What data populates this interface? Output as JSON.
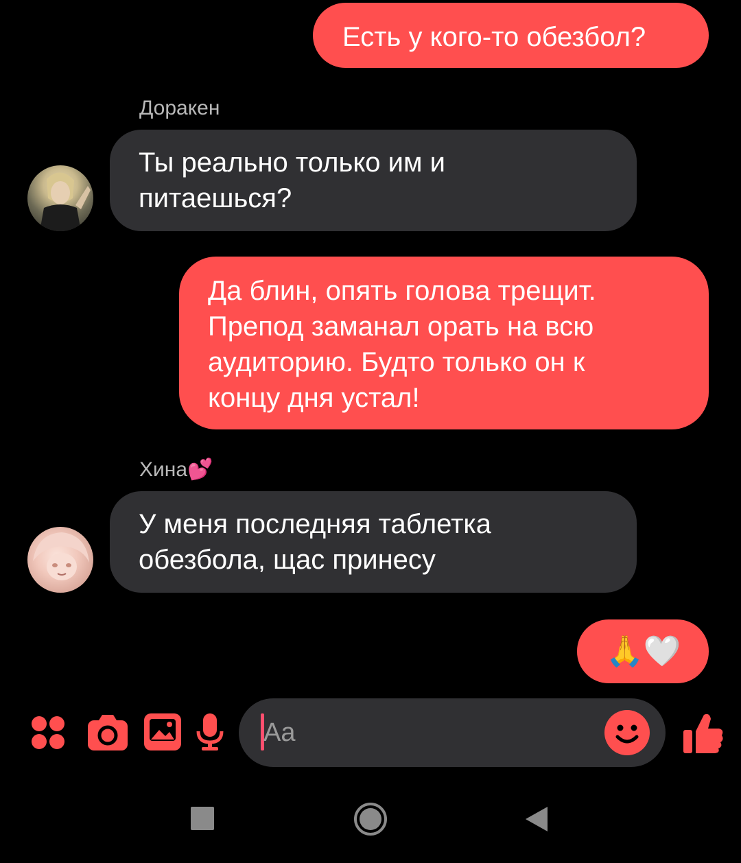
{
  "messages": [
    {
      "id": "m1",
      "direction": "outgoing",
      "text": "Есть у кого-то обезбол?"
    },
    {
      "id": "m2",
      "direction": "incoming",
      "sender": "Доракен",
      "avatar": "doraken-avatar",
      "text": "Ты реально только им и\nпитаешься?"
    },
    {
      "id": "m3",
      "direction": "outgoing",
      "text": "Да блин, опять голова трещит.\nПрепод заманал орать на всю\nаудиторию. Будто только он к\nконцу дня устал!"
    },
    {
      "id": "m4",
      "direction": "incoming",
      "sender": "Хина💕",
      "avatar": "hina-avatar",
      "text": "У меня последняя таблетка\nобезбола, щас принесу"
    },
    {
      "id": "m5",
      "direction": "outgoing",
      "text": "🙏🤍"
    }
  ],
  "composer": {
    "placeholder": "Aa",
    "icons": [
      "apps-grid-icon",
      "camera-icon",
      "gallery-icon",
      "microphone-icon",
      "emoji-icon",
      "thumbs-up-icon"
    ]
  },
  "navbar": {
    "icons": [
      "recent-apps-icon",
      "home-icon",
      "back-icon"
    ]
  },
  "colors": {
    "accent": "#ff4f4f",
    "incoming_bubble": "#303033",
    "background": "#000000",
    "sender_name": "#b8b8b8"
  }
}
